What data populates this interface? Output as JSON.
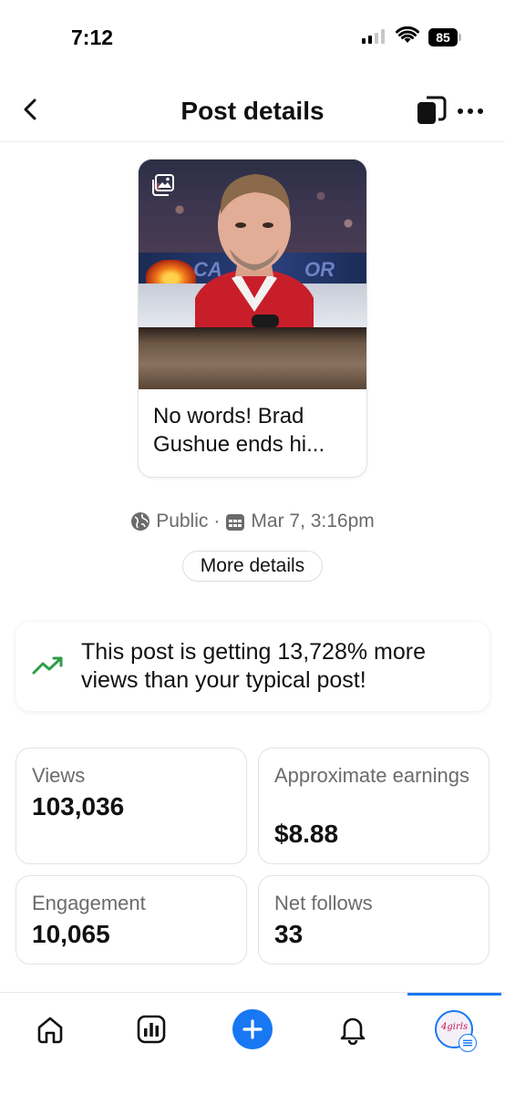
{
  "status_bar": {
    "time": "7:12",
    "battery": "85"
  },
  "header": {
    "title": "Post details"
  },
  "post": {
    "text": "No words!  Brad Gushue ends hi...",
    "board_left": "CA",
    "board_right": "OR RIBS"
  },
  "meta": {
    "visibility": "Public",
    "separator": "·",
    "date": "Mar 7, 3:16pm"
  },
  "more_details_label": "More details",
  "insight": {
    "text": "This post is getting 13,728% more views than your typical post!",
    "accent": "#2e9d47"
  },
  "stats": {
    "views": {
      "label": "Views",
      "value": "103,036"
    },
    "earnings": {
      "label": "Approximate earnings",
      "value": "$8.88"
    },
    "engagement": {
      "label": "Engagement",
      "value": "10,065"
    },
    "follows": {
      "label": "Net follows",
      "value": "33"
    }
  },
  "nav": {
    "items": [
      "home-icon",
      "insights-icon",
      "create-icon",
      "notifications-icon",
      "profile-avatar"
    ],
    "active": "profile-avatar",
    "accent": "#1877f2",
    "avatar_text": "4girls"
  }
}
